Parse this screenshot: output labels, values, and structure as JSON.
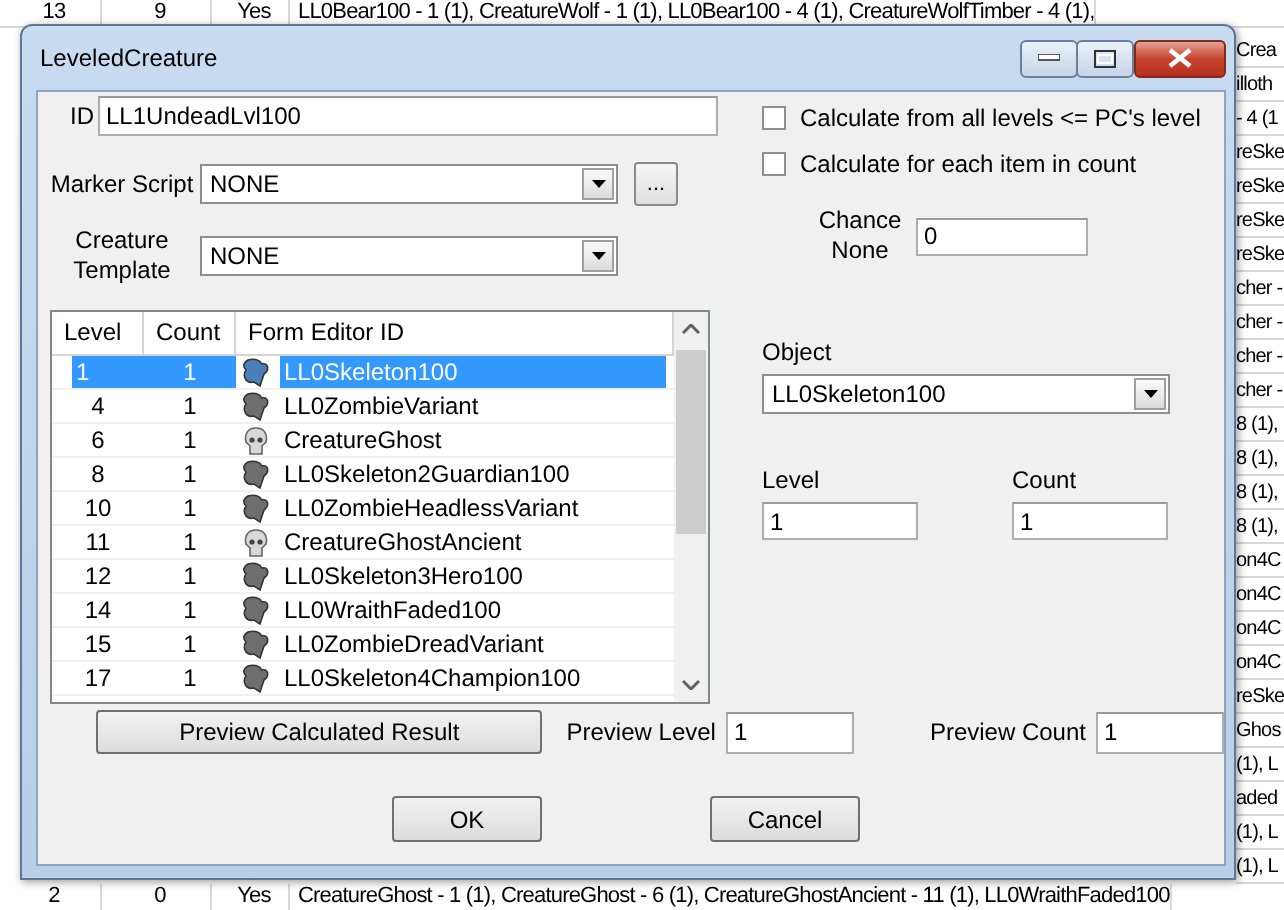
{
  "background_sheet": {
    "top_row": [
      "13",
      "9",
      "Yes",
      "LL0Bear100 - 1 (1), CreatureWolf - 1 (1), LL0Bear100 - 4 (1), CreatureWolfTimber - 4 (1),"
    ],
    "right_column": [
      "Crea",
      "illoth",
      "- 4 (1",
      "reSke",
      "reSke",
      "reSke",
      "reSke",
      "cher -",
      "cher -",
      "cher -",
      "cher -",
      "8 (1),",
      "8 (1),",
      "8 (1),",
      "8 (1),",
      "on4C",
      "on4C",
      "on4C",
      "on4C",
      "reSke",
      "Ghos",
      "(1), L",
      "aded",
      "(1), L",
      "(1), L"
    ],
    "bottom_row": [
      "2",
      "0",
      "Yes",
      "CreatureGhost - 1 (1), CreatureGhost - 6 (1), CreatureGhostAncient - 11 (1), LL0WraithFaded100"
    ]
  },
  "window": {
    "title": "LeveledCreature"
  },
  "id_field": {
    "label": "ID",
    "value": "LL1UndeadLvl100"
  },
  "marker_script": {
    "label": "Marker Script",
    "value": "NONE",
    "browse_button": "..."
  },
  "creature_template": {
    "label": "Creature Template",
    "value": "NONE"
  },
  "list": {
    "columns": [
      "Level",
      "Count",
      "Form Editor ID"
    ],
    "rows": [
      {
        "level": "1",
        "count": "1",
        "form_editor_id": "LL0Skeleton100",
        "kind": "leveled",
        "selected": true
      },
      {
        "level": "4",
        "count": "1",
        "form_editor_id": "LL0ZombieVariant",
        "kind": "leveled",
        "selected": false
      },
      {
        "level": "6",
        "count": "1",
        "form_editor_id": "CreatureGhost",
        "kind": "creature",
        "selected": false
      },
      {
        "level": "8",
        "count": "1",
        "form_editor_id": "LL0Skeleton2Guardian100",
        "kind": "leveled",
        "selected": false
      },
      {
        "level": "10",
        "count": "1",
        "form_editor_id": "LL0ZombieHeadlessVariant",
        "kind": "leveled",
        "selected": false
      },
      {
        "level": "11",
        "count": "1",
        "form_editor_id": "CreatureGhostAncient",
        "kind": "creature",
        "selected": false
      },
      {
        "level": "12",
        "count": "1",
        "form_editor_id": "LL0Skeleton3Hero100",
        "kind": "leveled",
        "selected": false
      },
      {
        "level": "14",
        "count": "1",
        "form_editor_id": "LL0WraithFaded100",
        "kind": "leveled",
        "selected": false
      },
      {
        "level": "15",
        "count": "1",
        "form_editor_id": "LL0ZombieDreadVariant",
        "kind": "leveled",
        "selected": false
      },
      {
        "level": "17",
        "count": "1",
        "form_editor_id": "LL0Skeleton4Champion100",
        "kind": "leveled",
        "selected": false
      }
    ]
  },
  "options": [
    {
      "label": "Calculate from all levels <= PC's level",
      "checked": false
    },
    {
      "label": "Calculate for each item in count",
      "checked": false
    }
  ],
  "chance_none": {
    "label": "Chance None",
    "value": "0"
  },
  "object": {
    "label": "Object",
    "value": "LL0Skeleton100"
  },
  "level": {
    "label": "Level",
    "value": "1"
  },
  "count": {
    "label": "Count",
    "value": "1"
  },
  "preview_button": "Preview Calculated Result",
  "preview_level": {
    "label": "Preview Level",
    "value": "1"
  },
  "preview_count": {
    "label": "Preview Count",
    "value": "1"
  },
  "buttons": [
    "OK",
    "Cancel"
  ]
}
